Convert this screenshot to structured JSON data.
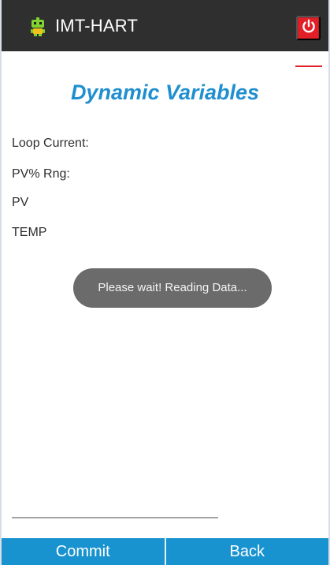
{
  "app": {
    "title": "IMT-HART",
    "icons": {
      "app": "robot-icon",
      "power": "power-icon"
    },
    "colors": {
      "appbar": "#2f2f2f",
      "accent_red": "#e21f26",
      "title_blue": "#1f8fcf",
      "button_blue": "#1893cf",
      "toast_bg": "#6b6b6b"
    }
  },
  "page": {
    "title": "Dynamic Variables",
    "variables": [
      {
        "label": "Loop Current:"
      },
      {
        "label": "PV% Rng:"
      },
      {
        "label": "PV"
      },
      {
        "label": "TEMP"
      }
    ],
    "toast": "Please wait! Reading Data..."
  },
  "footer": {
    "commit_label": "Commit",
    "back_label": "Back"
  }
}
